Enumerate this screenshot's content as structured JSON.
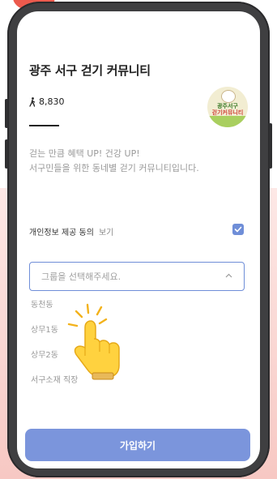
{
  "community": {
    "title": "광주 서구 걷기 커뮤니티",
    "steps": "8,830",
    "badge_line1": "광주서구",
    "badge_line2": "걷기커뮤니티",
    "description_line1": "걷는 만큼 혜택 UP! 건강 UP!",
    "description_line2": "서구민들을 위한 동네별 걷기 커뮤니티입니다."
  },
  "consent": {
    "label": "개인정보 제공 동의",
    "view_label": "보기",
    "checked": true
  },
  "group_select": {
    "placeholder": "그룹을 선택해주세요.",
    "options": [
      "동천동",
      "상무1동",
      "상무2동",
      "서구소재 직장"
    ]
  },
  "join_button": {
    "label": "가입하기"
  },
  "colors": {
    "accent": "#7b95dc",
    "phone_frame": "#3f3f41",
    "background_band": "#f7c8c3"
  }
}
